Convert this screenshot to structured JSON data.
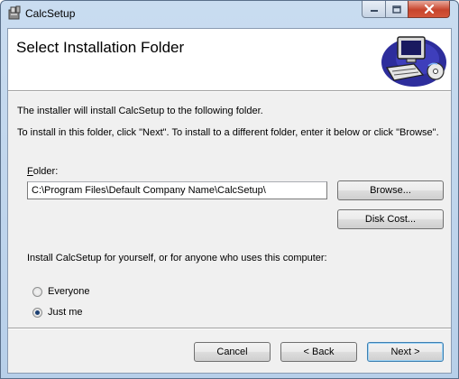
{
  "window": {
    "title": "CalcSetup",
    "minimize_label": "",
    "maximize_label": "",
    "close_label": ""
  },
  "banner": {
    "title": "Select Installation Folder"
  },
  "body": {
    "line1": "The installer will install CalcSetup to the following folder.",
    "line2": "To install in this folder, click \"Next\". To install to a different folder, enter it below or click \"Browse\".",
    "folder_label_accel": "F",
    "folder_label_rest": "older:",
    "folder_value": "C:\\Program Files\\Default Company Name\\CalcSetup\\",
    "browse_label": "Browse...",
    "disk_cost_label": "Disk Cost...",
    "install_for_text": "Install CalcSetup for yourself, or for anyone who uses this computer:",
    "options": [
      {
        "label": "Everyone",
        "checked": false
      },
      {
        "label": "Just me",
        "checked": true
      }
    ]
  },
  "footer": {
    "cancel_label": "Cancel",
    "back_label": "< Back",
    "next_label": "Next >"
  },
  "icons": {
    "app": "setup-box-icon",
    "banner": "computer-install-icon"
  }
}
